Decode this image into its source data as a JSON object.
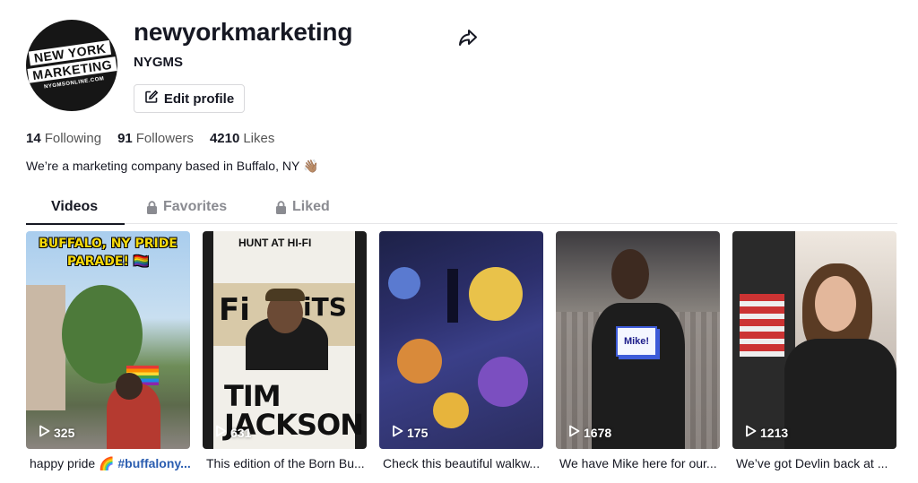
{
  "profile": {
    "username": "newyorkmarketing",
    "nickname": "NYGMS",
    "edit_label": "Edit profile",
    "avatar_lines": [
      "NEW YORK",
      "MARKETING",
      "NYGMSONLINE.COM"
    ],
    "bio": "We’re a marketing company based in Buffalo, NY 👋🏽"
  },
  "stats": {
    "following_count": "14",
    "following_label": "Following",
    "followers_count": "91",
    "followers_label": "Followers",
    "likes_count": "4210",
    "likes_label": "Likes"
  },
  "tabs": {
    "videos": "Videos",
    "favorites": "Favorites",
    "liked": "Liked",
    "active": "Videos"
  },
  "videos": [
    {
      "views": "325",
      "caption_text": "happy pride 🌈 ",
      "caption_tag": "#buffalony...",
      "overlay_text": [
        "BUFFALO, NY PRIDE",
        "PARADE! 🏳️‍🌈"
      ]
    },
    {
      "views": "631",
      "caption_text": "This edition of the Born Bu...",
      "overlay_text": [
        "HUNT AT HI-FI",
        "Fi",
        "iTS",
        "TIM",
        "JACKSON"
      ]
    },
    {
      "views": "175",
      "caption_text": "Check this beautiful walkw..."
    },
    {
      "views": "1678",
      "caption_text": "We have Mike here for our...",
      "overlay_text": [
        "Mike!"
      ]
    },
    {
      "views": "1213",
      "caption_text": "We’ve got Devlin back at ..."
    }
  ],
  "icons": {
    "share": "share-arrow-icon",
    "edit": "edit-pencil-icon",
    "lock": "lock-icon",
    "play": "play-icon"
  },
  "colors": {
    "text": "#161823",
    "muted": "#8a8b91",
    "tag": "#2a5db0"
  }
}
